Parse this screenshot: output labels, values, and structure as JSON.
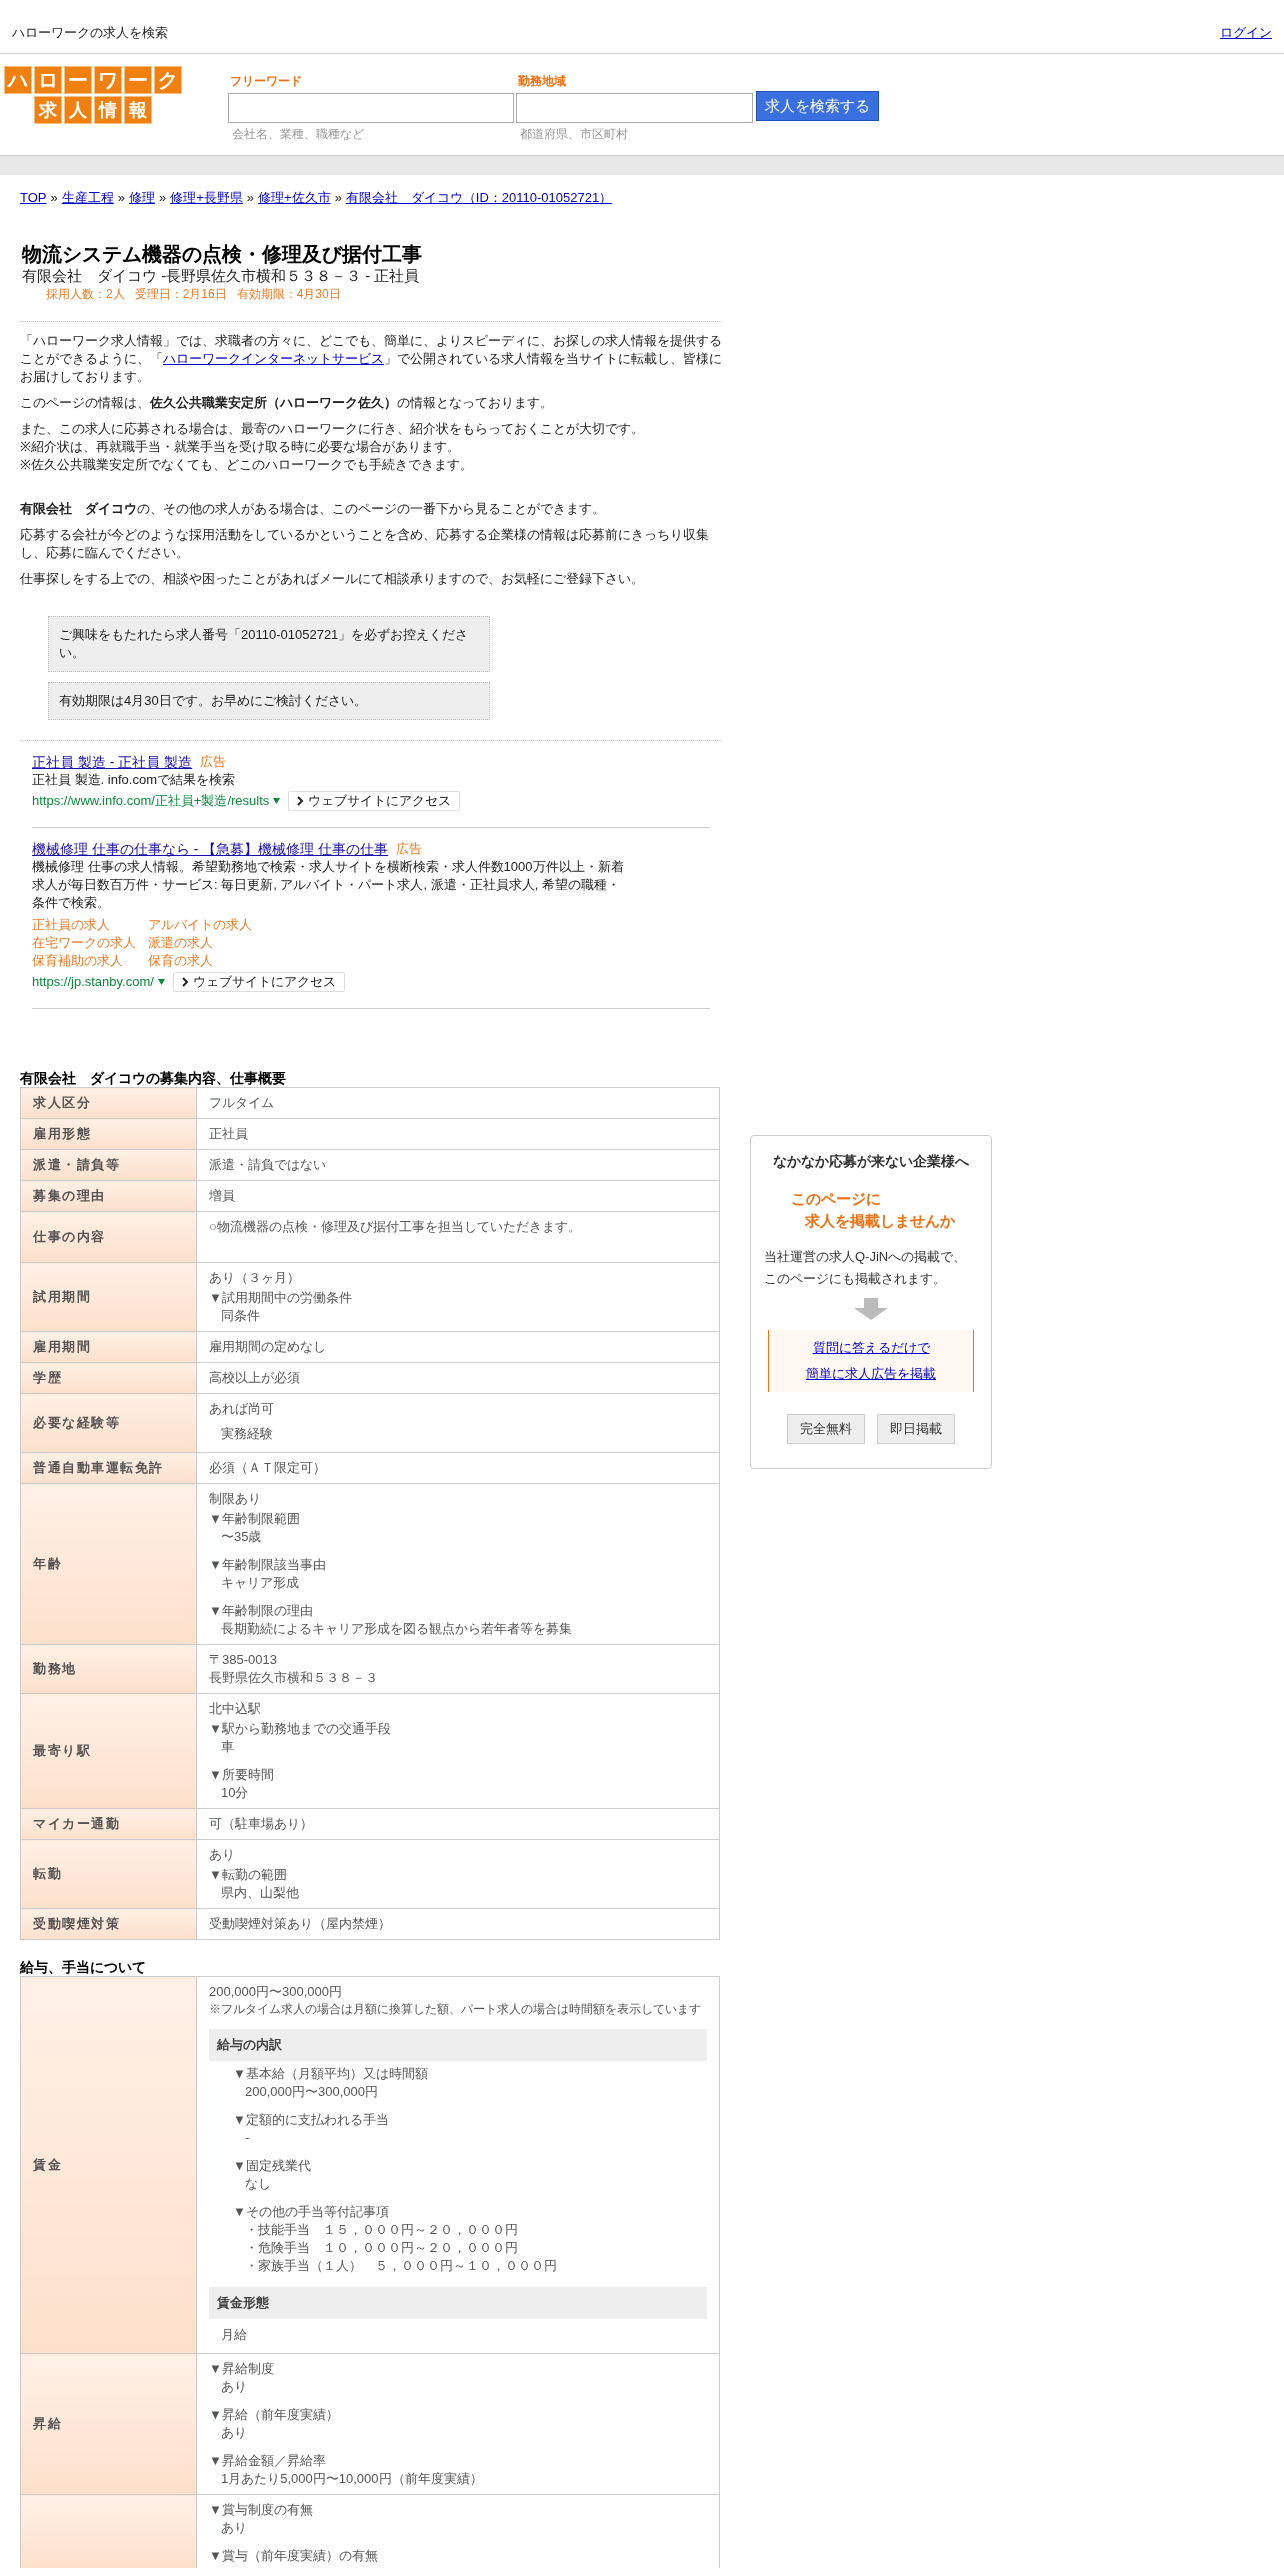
{
  "top_bar": {
    "title": "ハローワークの求人を検索",
    "login": "ログイン"
  },
  "logo": {
    "line1": "ハローワーク",
    "line2": "求人情報"
  },
  "search": {
    "fields": [
      {
        "label": "フリーワード",
        "hint": "会社名、業種、職種など"
      },
      {
        "label": "勤務地域",
        "hint": "都道府県、市区町村"
      }
    ],
    "button": "求人を検索する"
  },
  "breadcrumb": {
    "separator": "»",
    "items": [
      "TOP",
      "生産工程",
      "修理",
      "修理+長野県",
      "修理+佐久市",
      "有限会社　ダイコウ（ID：20110-01052721）"
    ]
  },
  "job": {
    "title": "物流システム機器の点検・修理及び据付工事",
    "subtitle": "有限会社　ダイコウ -長野県佐久市横和５３８－３ - 正社員",
    "meta": "採用人数：2人   受理日：2月16日   有効期限：4月30日"
  },
  "intro": [
    {
      "parts": [
        {
          "kind": "text",
          "text": "「ハローワーク求人情報」では、求職者の方々に、どこでも、簡単に、よりスピーディに、お探しの求人情報を提供することができるように、「"
        },
        {
          "kind": "link",
          "text": "ハローワークインターネットサービス"
        },
        {
          "kind": "text",
          "text": "」で公開されている求人情報を当サイトに転載し、皆様にお届けしております。"
        }
      ]
    },
    {
      "parts": [
        {
          "kind": "text",
          "text": "このページの情報は、**佐久公共職業安定所（ハローワーク佐久）**の情報となっております。"
        }
      ]
    },
    {
      "parts": [
        {
          "kind": "text",
          "text": "また、この求人に応募される場合は、最寄のハローワークに行き、紹介状をもらっておくことが大切です。\n※紹介状は、再就職手当・就業手当を受け取る時に必要な場合があります。\n※佐久公共職業安定所でなくても、どこのハローワークでも手続きできます。"
        }
      ]
    },
    {
      "parts": [
        {
          "kind": "text",
          "text": "**有限会社　ダイコウ**の、その他の求人がある場合は、このページの一番下から見ることができます。"
        }
      ]
    },
    {
      "parts": [
        {
          "kind": "text",
          "text": "応募する会社が今どのような採用活動をしているかということを含め、応募する企業様の情報は応募前にきっちり収集し、応募に臨んでください。"
        }
      ]
    },
    {
      "parts": [
        {
          "kind": "text",
          "text": "仕事探しをする上での、相談や困ったことがあればメールにて相談承りますので、お気軽にご登録下さい。"
        }
      ]
    }
  ],
  "notices": [
    "ご興味をもたれたら求人番号「20110-01052721」を必ずお控えください。",
    "有効期限は4月30日です。お早めにご検討ください。"
  ],
  "ads": [
    {
      "title": "正社員 製造 - 正社員 製造",
      "tag": "広告",
      "description": "正社員 製造. info.comで結果を検索",
      "url": "https://www.info.com/正社員+製造/results",
      "visit": "ウェブサイトにアクセス"
    },
    {
      "title": "機械修理 仕事の仕事なら - 【急募】機械修理 仕事の仕事",
      "tag": "広告",
      "description": "機械修理 仕事の求人情報。希望勤務地で検索・求人サイトを横断検索・求人件数1000万件以上・新着求人が毎日数百万件・サービス: 毎日更新, アルバイト・パート求人, 派遣・正社員求人, 希望の職種・条件で検索。",
      "sitelinks": [
        "正社員の求人",
        "アルバイトの求人",
        "在宅ワークの求人",
        "派遣の求人",
        "保育補助の求人",
        "保育の求人"
      ],
      "url": "https://jp.stanby.com/",
      "visit": "ウェブサイトにアクセス"
    }
  ],
  "summary": {
    "heading": "有限会社　ダイコウの募集内容、仕事概要",
    "rows": [
      {
        "label": "求人区分",
        "blocks": [
          {
            "kind": "text",
            "lines": [
              "フルタイム"
            ]
          }
        ]
      },
      {
        "label": "雇用形態",
        "blocks": [
          {
            "kind": "text",
            "lines": [
              "正社員"
            ]
          }
        ]
      },
      {
        "label": "派遣・請負等",
        "blocks": [
          {
            "kind": "text",
            "lines": [
              "派遣・請負ではない"
            ]
          }
        ]
      },
      {
        "label": "募集の理由",
        "blocks": [
          {
            "kind": "text",
            "lines": [
              "増員"
            ]
          }
        ]
      },
      {
        "label": "仕事の内容",
        "blocks": [
          {
            "kind": "text",
            "lines": [
              "○物流機器の点検・修理及び据付工事を担当していただきます。"
            ]
          },
          {
            "kind": "blank"
          }
        ]
      },
      {
        "label": "試用期間",
        "blocks": [
          {
            "kind": "text",
            "lines": [
              "あり（３ヶ月）"
            ]
          },
          {
            "kind": "item",
            "title": "▼試用期間中の労働条件",
            "lines": [
              "同条件"
            ]
          }
        ]
      },
      {
        "label": "雇用期間",
        "blocks": [
          {
            "kind": "text",
            "lines": [
              "雇用期間の定めなし"
            ]
          }
        ]
      },
      {
        "label": "学歴",
        "blocks": [
          {
            "kind": "text",
            "lines": [
              "高校以上が必須"
            ]
          }
        ]
      },
      {
        "label": "必要な経験等",
        "blocks": [
          {
            "kind": "text",
            "lines": [
              "あれば尚可"
            ]
          },
          {
            "kind": "value",
            "lines": [
              "実務経験"
            ]
          }
        ]
      },
      {
        "label": "普通自動車運転免許",
        "blocks": [
          {
            "kind": "text",
            "lines": [
              "必須（ＡＴ限定可）"
            ]
          }
        ]
      },
      {
        "label": "年齢",
        "blocks": [
          {
            "kind": "text",
            "lines": [
              "制限あり"
            ]
          },
          {
            "kind": "item",
            "title": "▼年齢制限範囲",
            "lines": [
              "〜35歳"
            ]
          },
          {
            "kind": "item",
            "title": "▼年齢制限該当事由",
            "lines": [
              "キャリア形成"
            ]
          },
          {
            "kind": "item",
            "title": "▼年齢制限の理由",
            "lines": [
              "長期勤続によるキャリア形成を図る観点から若年者等を募集"
            ]
          }
        ]
      },
      {
        "label": "勤務地",
        "blocks": [
          {
            "kind": "text",
            "lines": [
              "〒385-0013",
              "長野県佐久市横和５３８－３"
            ]
          }
        ]
      },
      {
        "label": "最寄り駅",
        "blocks": [
          {
            "kind": "text",
            "lines": [
              "北中込駅"
            ]
          },
          {
            "kind": "item",
            "title": "▼駅から勤務地までの交通手段",
            "lines": [
              "車"
            ]
          },
          {
            "kind": "item",
            "title": "▼所要時間",
            "lines": [
              "10分"
            ]
          }
        ]
      },
      {
        "label": "マイカー通勤",
        "blocks": [
          {
            "kind": "text",
            "lines": [
              "可（駐車場あり）"
            ]
          }
        ]
      },
      {
        "label": "転勤",
        "blocks": [
          {
            "kind": "text",
            "lines": [
              "あり"
            ]
          },
          {
            "kind": "item",
            "title": "▼転勤の範囲",
            "lines": [
              "県内、山梨他"
            ]
          }
        ]
      },
      {
        "label": "受動喫煙対策",
        "blocks": [
          {
            "kind": "text",
            "lines": [
              "受動喫煙対策あり（屋内禁煙）"
            ]
          }
        ]
      }
    ]
  },
  "sidebar": {
    "title": "なかなか応募が来ない企業様へ",
    "pitch": [
      "このページに",
      "求人を掲載しませんか"
    ],
    "text": "当社運営の求人Q-JiNへの掲載で、このページにも掲載されます。",
    "links": [
      "質問に答えるだけで",
      "簡単に求人広告を掲載"
    ],
    "tags": [
      "完全無料",
      "即日掲載"
    ]
  },
  "salary": {
    "heading": "給与、手当について",
    "rows": [
      {
        "label": "賃金",
        "blocks": [
          {
            "kind": "text",
            "lines": [
              "200,000円〜300,000円"
            ]
          },
          {
            "kind": "note",
            "lines": [
              "※フルタイム求人の場合は月額に換算した額、パート求人の場合は時間額を表示しています"
            ]
          },
          {
            "kind": "section",
            "title": "給与の内訳"
          },
          {
            "kind": "subitem",
            "title": "▼基本給（月額平均）又は時間額",
            "lines": [
              "200,000円〜300,000円"
            ]
          },
          {
            "kind": "subitem",
            "title": "▼定額的に支払われる手当",
            "lines": [
              "-"
            ]
          },
          {
            "kind": "subitem",
            "title": "▼固定残業代",
            "lines": [
              "なし"
            ]
          },
          {
            "kind": "subitem",
            "title": "▼その他の手当等付記事項",
            "lines": [
              "・技能手当　１５，０００円～２０，０００円",
              "・危険手当　１０，０００円～２０，０００円",
              "・家族手当（１人）　５，０００円～１０，０００円"
            ]
          },
          {
            "kind": "section",
            "title": "賃金形態"
          },
          {
            "kind": "value",
            "lines": [
              "月給"
            ]
          }
        ]
      },
      {
        "label": "昇給",
        "blocks": [
          {
            "kind": "item",
            "title": "▼昇給制度",
            "lines": [
              "あり"
            ]
          },
          {
            "kind": "item",
            "title": "▼昇給（前年度実績）",
            "lines": [
              "あり"
            ]
          },
          {
            "kind": "item",
            "title": "▼昇給金額／昇給率",
            "lines": [
              "1月あたり5,000円〜10,000円（前年度実績）"
            ]
          }
        ]
      },
      {
        "blocks": [
          {
            "kind": "item",
            "title": "▼賞与制度の有無",
            "lines": [
              "あり"
            ]
          },
          {
            "kind": "item",
            "title": "▼賞与（前年度実績）の有無"
          }
        ]
      }
    ]
  }
}
